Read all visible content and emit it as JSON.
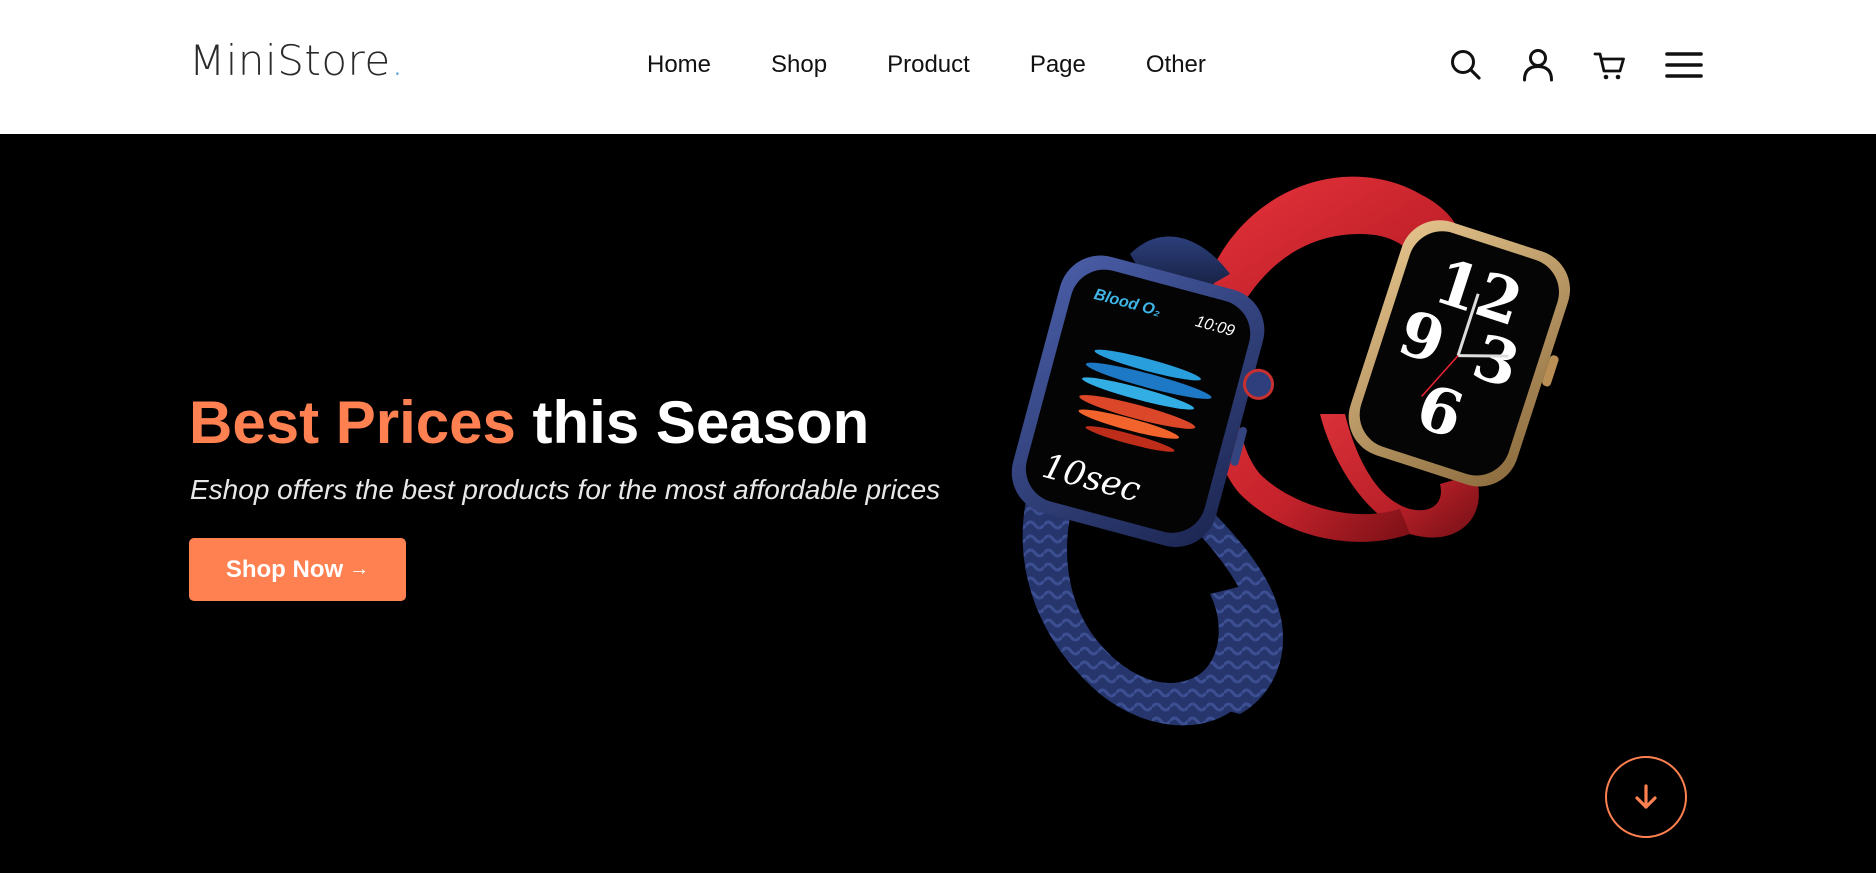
{
  "brand": {
    "logo_text": "MiniStore",
    "logo_dot": ".",
    "accent_color": "#ff8050",
    "dot_color": "#5aa6d8"
  },
  "nav": {
    "items": [
      {
        "label": "Home"
      },
      {
        "label": "Shop"
      },
      {
        "label": "Product"
      },
      {
        "label": "Page"
      },
      {
        "label": "Other"
      }
    ]
  },
  "header_icons": [
    "search-icon",
    "user-icon",
    "cart-icon",
    "menu-icon"
  ],
  "hero": {
    "headline_accent": "Best Prices",
    "headline_rest": "this Season",
    "subtitle": "Eshop offers the best products for the most affordable prices",
    "cta_label": "Shop Now",
    "cta_arrow": "→",
    "watch_screen_left": {
      "metric_label": "Blood O₂",
      "time": "10:09",
      "timer": "10sec"
    },
    "watch_screen_right": {
      "digits": "12 9 6 3"
    },
    "scroll_icon": "arrow-down-icon"
  }
}
